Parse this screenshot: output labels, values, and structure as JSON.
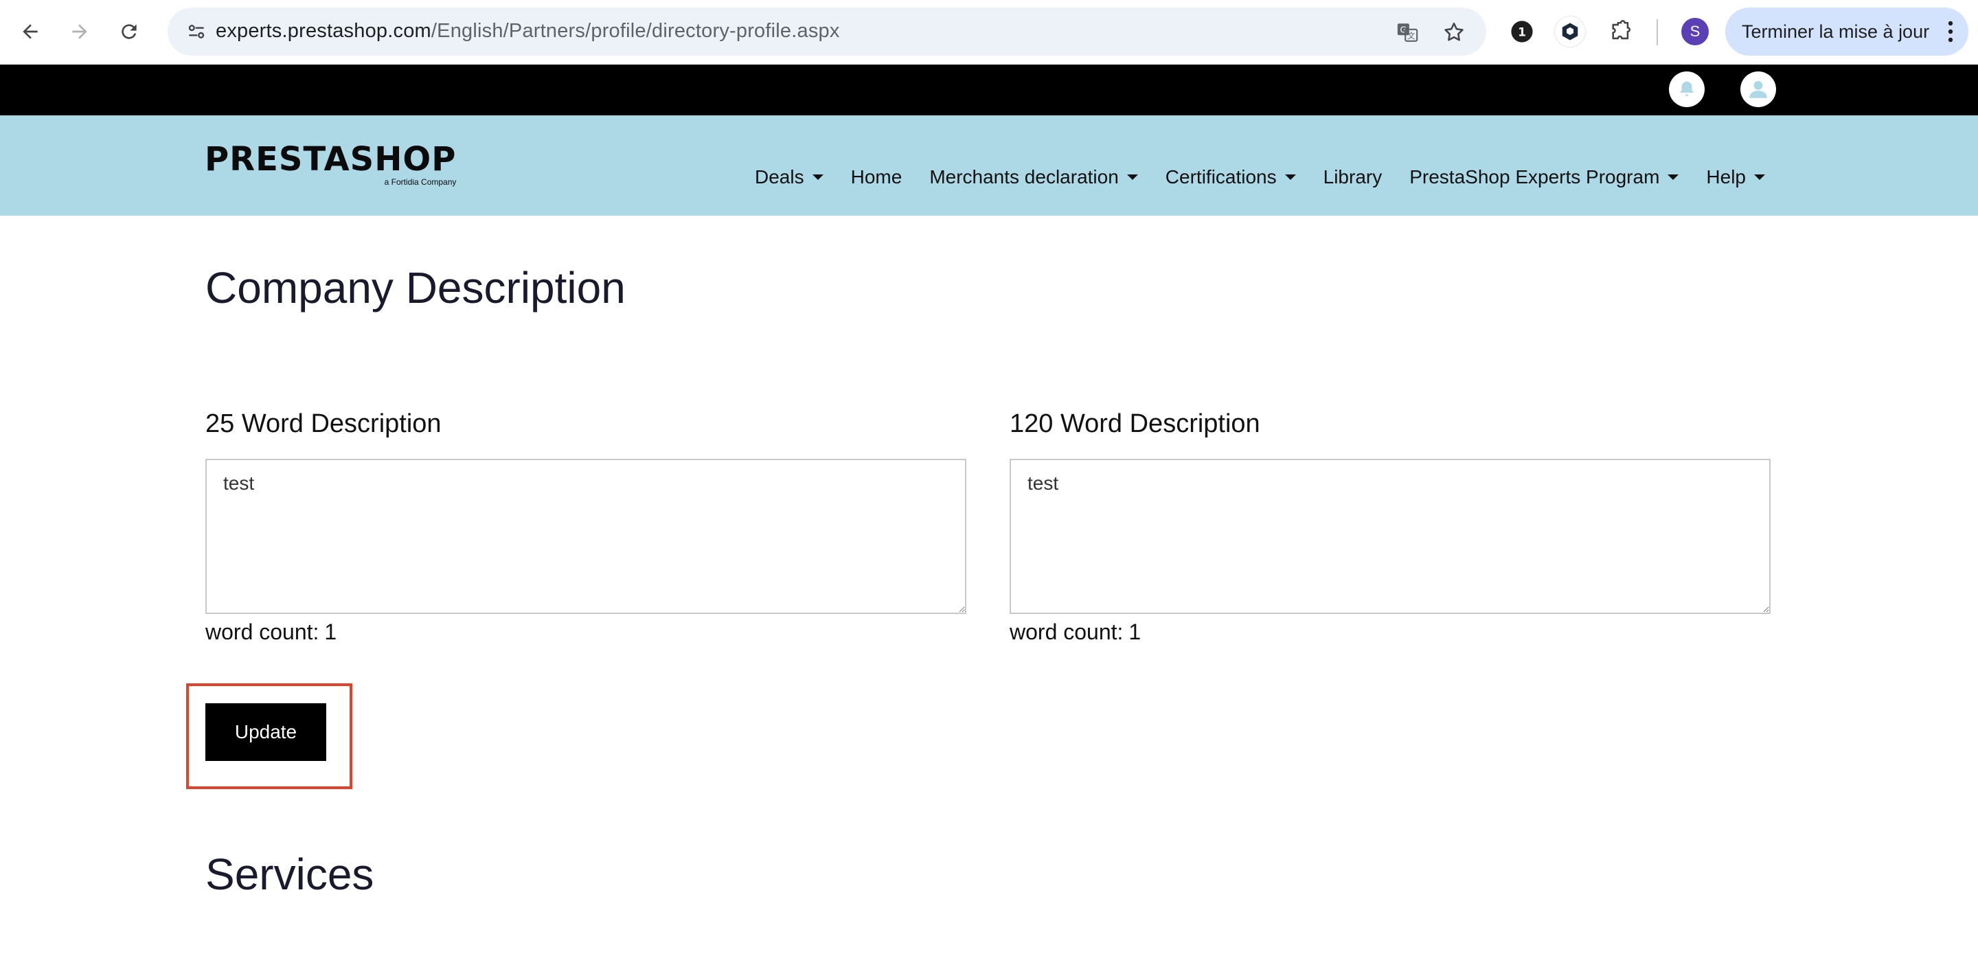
{
  "browser": {
    "url_host": "experts.prestashop.com",
    "url_path": "/English/Partners/profile/directory-profile.aspx",
    "profile_initial": "S",
    "update_label": "Terminer la mise à jour",
    "extension_badge": "1"
  },
  "header": {
    "logo_word": "PRESTASHOP",
    "logo_tag": "a Fortidia Company",
    "menu": [
      {
        "label": "Deals",
        "dropdown": true
      },
      {
        "label": "Home",
        "dropdown": false
      },
      {
        "label": "Merchants declaration",
        "dropdown": true
      },
      {
        "label": "Certifications",
        "dropdown": true
      },
      {
        "label": "Library",
        "dropdown": false
      },
      {
        "label": "PrestaShop Experts Program",
        "dropdown": true
      },
      {
        "label": "Help",
        "dropdown": true
      }
    ]
  },
  "main": {
    "title": "Company Description",
    "short_desc": {
      "label": "25 Word Description",
      "value": "test",
      "word_count_label": "word count:",
      "word_count": "1"
    },
    "long_desc": {
      "label": "120 Word Description",
      "value": "test",
      "word_count_label": "word count:",
      "word_count": "1"
    },
    "update_label": "Update",
    "services_title": "Services"
  },
  "colors": {
    "header_bg": "#add8e6",
    "topbar_bg": "#000000",
    "highlight": "#e0412b",
    "accent_profile": "#5b3fb5"
  }
}
